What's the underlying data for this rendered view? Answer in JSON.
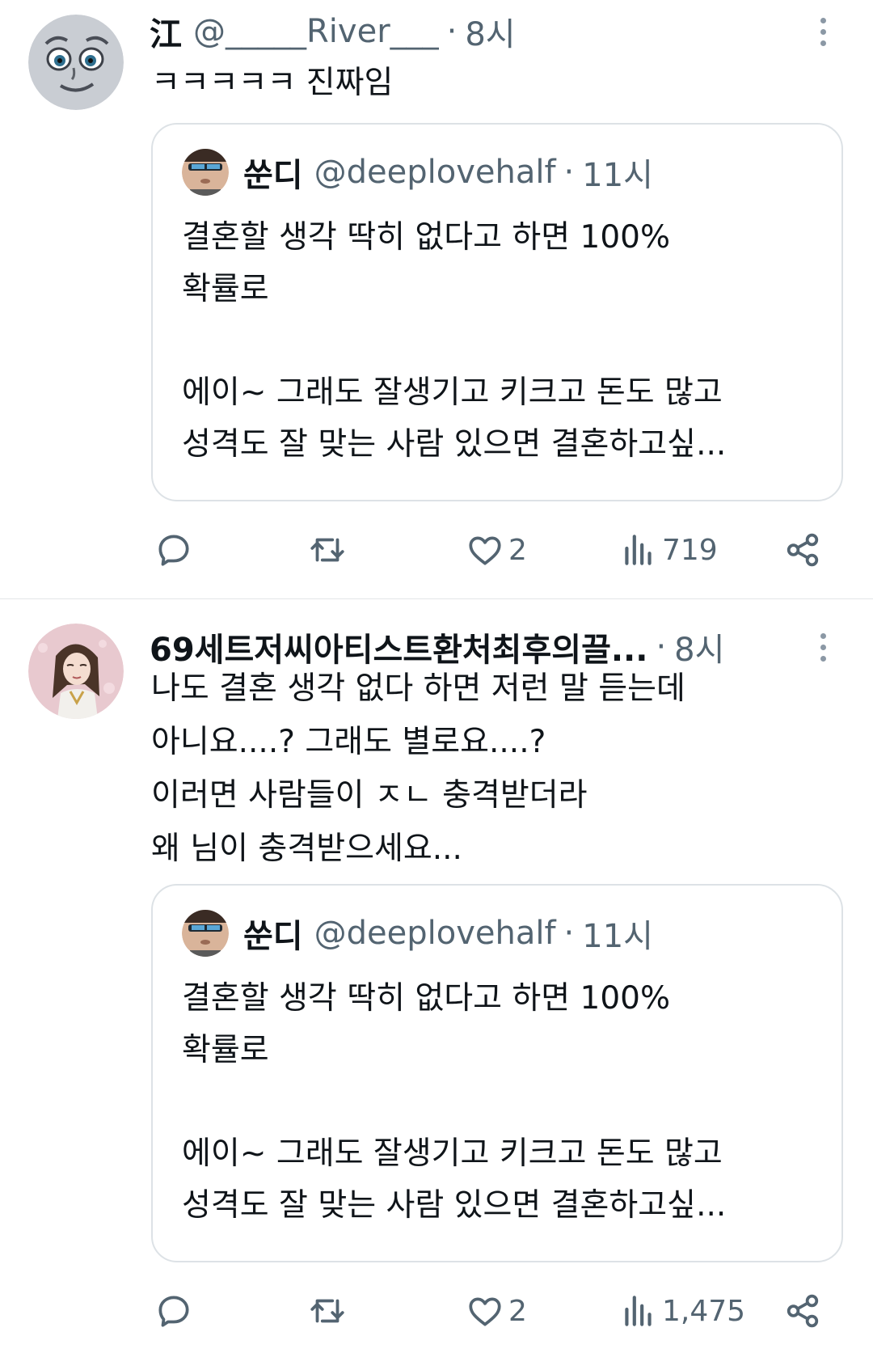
{
  "tweets": [
    {
      "name": "江",
      "handle": "@_____River___",
      "dot": "·",
      "time": "8시",
      "text": "ㅋㅋㅋㅋㅋ 진짜임",
      "quote": {
        "name": "쑨디",
        "handle": "@deeplovehalf",
        "dot": "·",
        "time": "11시",
        "text": "결혼할 생각 딱히 없다고 하면 100%\n확률로\n\n에이~ 그래도 잘생기고 키크고 돈도 많고\n성격도 잘 맞는 사람 있으면 결혼하고싶..."
      },
      "actions": {
        "likes": "2",
        "views": "719"
      }
    },
    {
      "name": "69세트저씨아티스트환처최후의끌...",
      "dot": "·",
      "time": "8시",
      "text": "나도 결혼 생각 없다 하면 저런 말 듣는데\n아니요....? 그래도 별로요....?\n이러면 사람들이 ㅈㄴ 충격받더라\n왜 님이 충격받으세요...",
      "quote": {
        "name": "쑨디",
        "handle": "@deeplovehalf",
        "dot": "·",
        "time": "11시",
        "text": "결혼할 생각 딱히 없다고 하면 100%\n확률로\n\n에이~ 그래도 잘생기고 키크고 돈도 많고\n성격도 잘 맞는 사람 있으면 결혼하고싶..."
      },
      "actions": {
        "likes": "2",
        "views": "1,475"
      }
    }
  ],
  "icons": {
    "reply": "reply-icon",
    "retweet": "retweet-icon",
    "like": "heart-icon",
    "views": "views-icon",
    "share": "share-icon",
    "more": "more-vertical-icon"
  },
  "colors": {
    "text": "#0f1419",
    "muted": "#536471",
    "border": "#dde2e6"
  }
}
